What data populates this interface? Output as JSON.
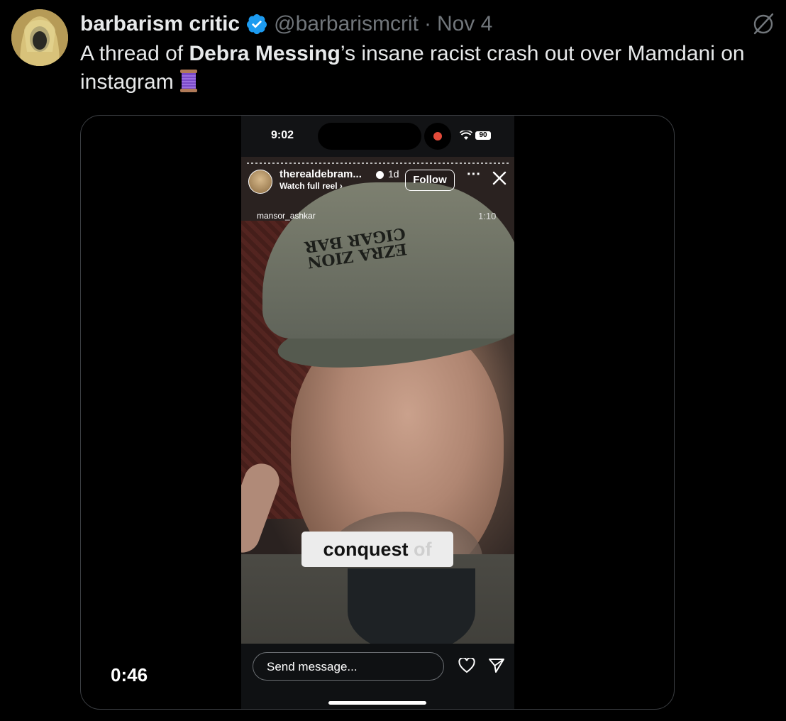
{
  "tweet": {
    "display_name": "barbarism critic",
    "handle": "@barbarismcrit",
    "separator": "·",
    "date": "Nov 4",
    "text_prefix": "A thread of ",
    "text_bold": "Debra Messing",
    "text_suffix": "’s insane racist crash out over Mamdani on instagram",
    "emoji": "spool-of-thread-icon"
  },
  "media": {
    "duration": "0:46",
    "phone": {
      "status_time": "9:02",
      "battery": "90",
      "story_user": "therealdebram...",
      "story_age": "1d",
      "watch_full_reel": "Watch full reel ›",
      "follow_label": "Follow",
      "more_label": "···",
      "repost_user": "mansor_ashkar",
      "repost_time": "1:10",
      "cap_text_line1": "EZRA ZION",
      "cap_text_line2": "CIGAR BAR",
      "caption_main": "conquest",
      "caption_fade": "of",
      "send_placeholder": "Send message..."
    }
  },
  "colors": {
    "background": "#000000",
    "text": "#e7e9ea",
    "muted": "#71767b",
    "verified_blue": "#1d9bf0"
  }
}
